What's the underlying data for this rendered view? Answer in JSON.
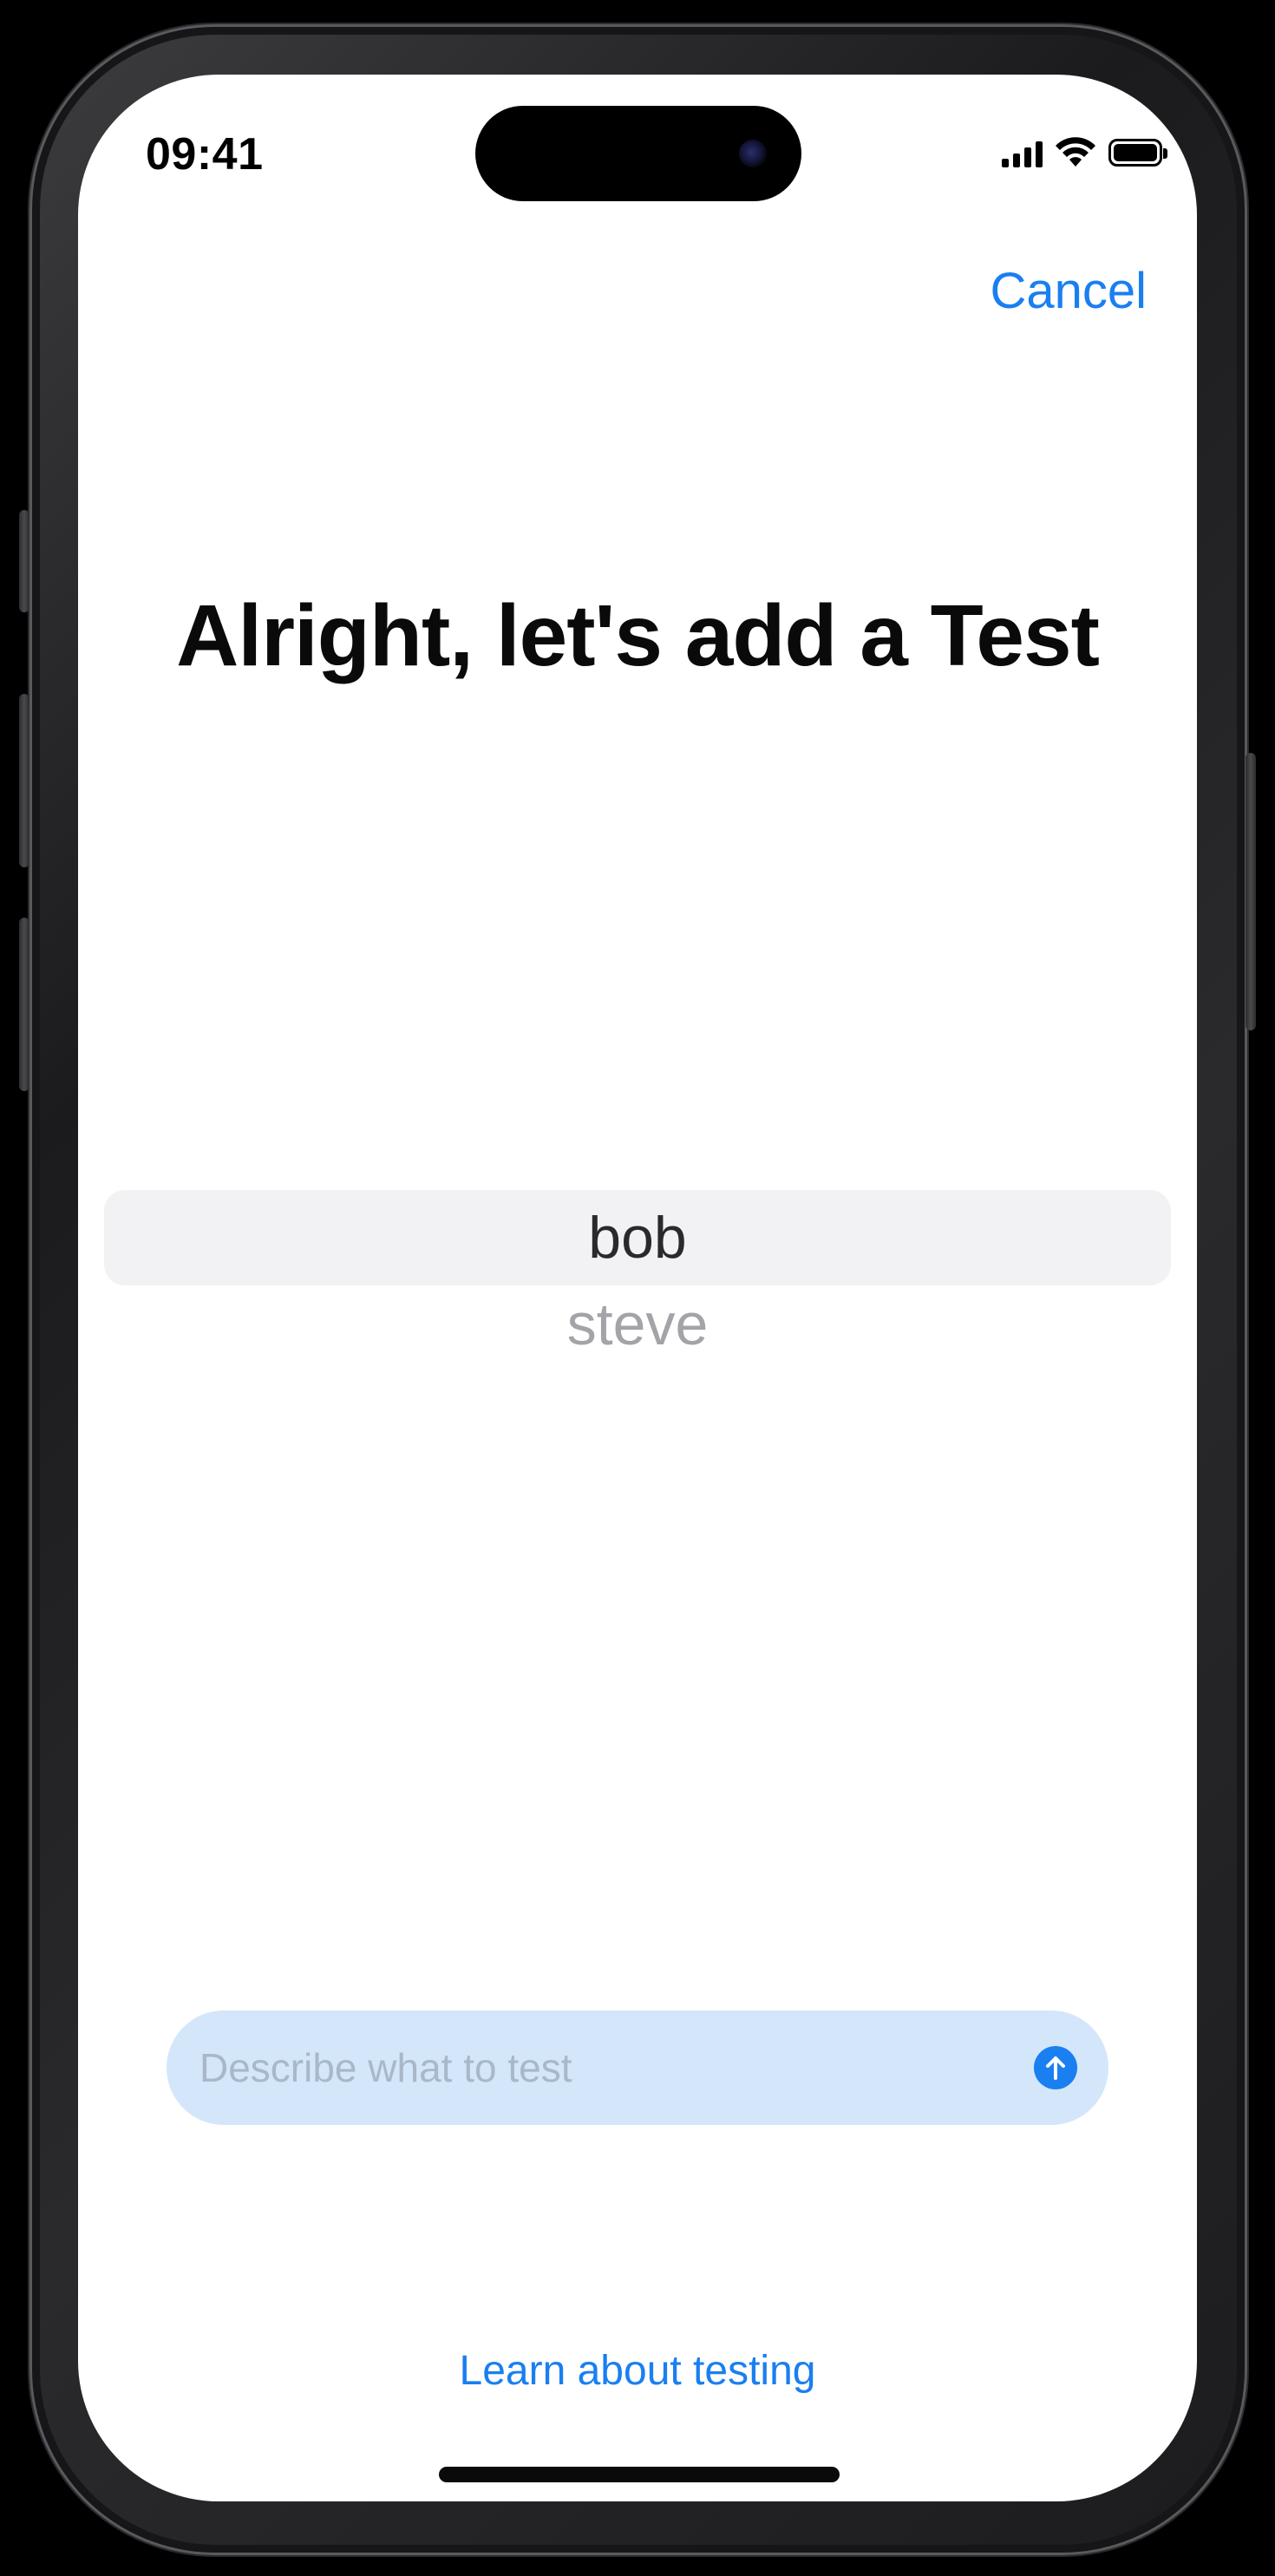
{
  "status_bar": {
    "time": "09:41",
    "icons": [
      "cellular-signal-icon",
      "wifi-icon",
      "battery-icon"
    ]
  },
  "nav": {
    "cancel_label": "Cancel"
  },
  "main": {
    "title": "Alright, let's add a Test"
  },
  "picker": {
    "selected": "bob",
    "options": [
      "bob",
      "steve"
    ]
  },
  "describe": {
    "placeholder": "Describe what to test",
    "value": "",
    "send_icon": "arrow-up-circle-icon"
  },
  "footer": {
    "learn_link": "Learn about testing"
  },
  "colors": {
    "accent": "#1A7FF0",
    "field_background": "#D4E6FA",
    "picker_selection": "#F2F2F4",
    "picker_inactive_text": "#A3A3A8"
  }
}
